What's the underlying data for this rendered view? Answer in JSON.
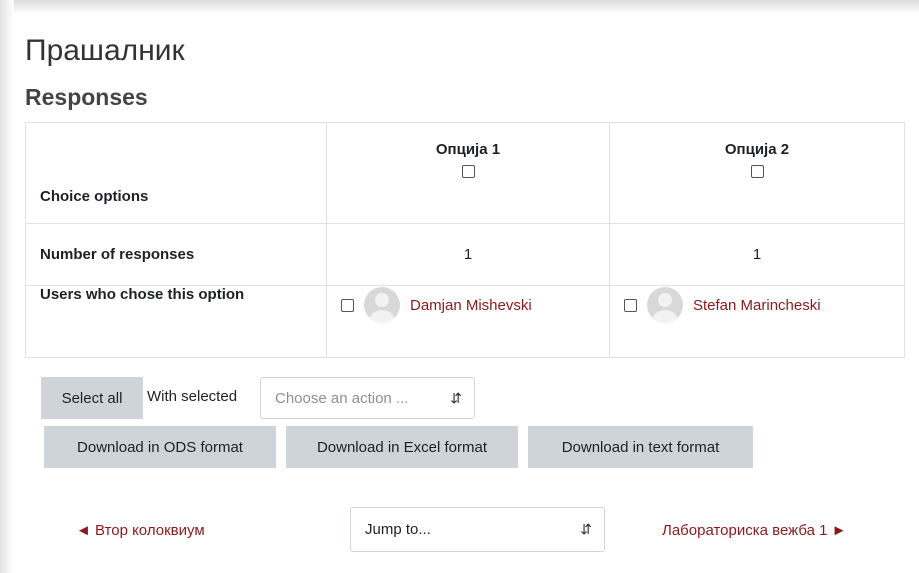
{
  "page": {
    "title": "Прашалник",
    "subtitle": "Responses"
  },
  "table": {
    "row_labels": {
      "choice_options": "Choice options",
      "number_of_responses": "Number of responses",
      "users_who_chose": "Users who chose this option"
    },
    "options": [
      {
        "name": "Опција 1",
        "count": "1",
        "user": "Damjan Mishevski"
      },
      {
        "name": "Опција 2",
        "count": "1",
        "user": "Stefan Marincheski"
      }
    ]
  },
  "actions": {
    "select_all": "Select all",
    "with_selected": "With selected",
    "choose_action_placeholder": "Choose an action ...",
    "download_ods": "Download in ODS format",
    "download_excel": "Download in Excel format",
    "download_text": "Download in text format"
  },
  "navigation": {
    "prev": "◄ Втор колоквиум",
    "jump_to": "Jump to...",
    "next": "Лабораториска вежба 1 ►"
  },
  "colors": {
    "link": "#8b1a1a",
    "button_bg": "#ced4da",
    "border": "#dee2e6"
  }
}
